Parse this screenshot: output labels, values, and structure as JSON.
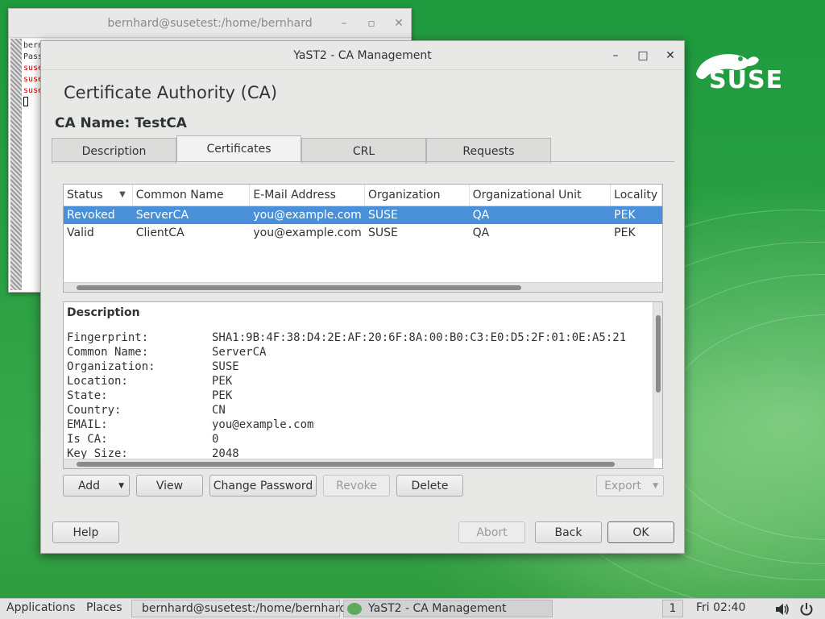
{
  "terminal": {
    "title": "bernhard@susetest:/home/bernhard",
    "lines": [
      "bern",
      "Pass",
      "suse",
      "suse",
      "suse"
    ]
  },
  "brand": {
    "logo_text": "SUSE",
    "color": "#ffffff"
  },
  "window": {
    "title": "YaST2 - CA Management",
    "heading": "Certificate Authority (CA)",
    "ca_name": "CA Name: TestCA",
    "tabs": [
      {
        "label": "Description",
        "active": false
      },
      {
        "label": "Certificates",
        "active": true
      },
      {
        "label": "CRL",
        "active": false
      },
      {
        "label": "Requests",
        "active": false
      }
    ],
    "table": {
      "columns": [
        "Status",
        "Common Name",
        "E-Mail Address",
        "Organization",
        "Organizational Unit",
        "Locality"
      ],
      "rows": [
        {
          "status": "Revoked",
          "common_name": "ServerCA",
          "email": "you@example.com",
          "organization": "SUSE",
          "unit": "QA",
          "locality": "PEK",
          "selected": true
        },
        {
          "status": "Valid",
          "common_name": "ClientCA",
          "email": "you@example.com",
          "organization": "SUSE",
          "unit": "QA",
          "locality": "PEK",
          "selected": false
        }
      ]
    },
    "description": {
      "title": "Description",
      "fields": [
        {
          "key": "Fingerprint:",
          "value": "SHA1:9B:4F:38:D4:2E:AF:20:6F:8A:00:B0:C3:E0:D5:2F:01:0E:A5:21"
        },
        {
          "key": "Common Name:",
          "value": "ServerCA"
        },
        {
          "key": "Organization:",
          "value": "SUSE"
        },
        {
          "key": "Location:",
          "value": "PEK"
        },
        {
          "key": "State:",
          "value": "PEK"
        },
        {
          "key": "Country:",
          "value": "CN"
        },
        {
          "key": "EMAIL:",
          "value": "you@example.com"
        },
        {
          "key": "Is CA:",
          "value": "0"
        },
        {
          "key": "Key Size:",
          "value": "2048"
        }
      ]
    },
    "actions": {
      "add": "Add",
      "view": "View",
      "change_password": "Change Password",
      "revoke": "Revoke",
      "delete": "Delete",
      "export": "Export"
    },
    "footer": {
      "help": "Help",
      "abort": "Abort",
      "back": "Back",
      "ok": "OK"
    }
  },
  "taskbar": {
    "applications": "Applications",
    "places": "Places",
    "tasks": [
      {
        "label": "bernhard@susetest:/home/bernhard",
        "active": false
      },
      {
        "label": "YaST2 - CA Management",
        "active": true
      }
    ],
    "workspace": "1",
    "clock": "Fri 02:40"
  },
  "colors": {
    "selection": "#4a90d9",
    "desktop_green": "#2aa043",
    "terminal_error": "#cc0000"
  }
}
